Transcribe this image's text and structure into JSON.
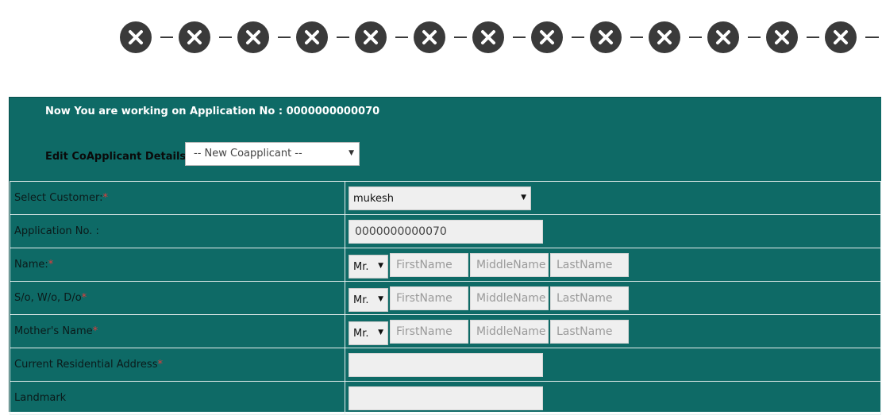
{
  "stepper": {
    "steps": [
      {
        "icon": "close-icon",
        "status": "incomplete"
      },
      {
        "icon": "close-icon",
        "status": "incomplete"
      },
      {
        "icon": "close-icon",
        "status": "incomplete"
      },
      {
        "icon": "close-icon",
        "status": "incomplete"
      },
      {
        "icon": "close-icon",
        "status": "incomplete"
      },
      {
        "icon": "close-icon",
        "status": "incomplete"
      },
      {
        "icon": "close-icon",
        "status": "incomplete"
      },
      {
        "icon": "close-icon",
        "status": "incomplete"
      },
      {
        "icon": "close-icon",
        "status": "incomplete"
      },
      {
        "icon": "close-icon",
        "status": "incomplete"
      },
      {
        "icon": "close-icon",
        "status": "incomplete"
      },
      {
        "icon": "close-icon",
        "status": "incomplete"
      },
      {
        "icon": "close-icon",
        "status": "incomplete"
      }
    ]
  },
  "header": {
    "application_text": "Now You are working on Application No : 0000000000070",
    "coapplicant_label": "Edit CoApplicant Details",
    "coapplicant_selected": "-- New Coapplicant --"
  },
  "form": {
    "select_customer": {
      "label": "Select Customer:",
      "required": "*",
      "value": "mukesh"
    },
    "application_no": {
      "label": "Application No. :",
      "value": "0000000000070"
    },
    "name": {
      "label": "Name:",
      "required": "*",
      "title": "Mr.",
      "first_ph": "FirstName",
      "middle_ph": "MiddleName",
      "last_ph": "LastName"
    },
    "relation": {
      "label": "S/o, W/o, D/o",
      "required": "*",
      "title": "Mr.",
      "first_ph": "FirstName",
      "middle_ph": "MiddleName",
      "last_ph": "LastName"
    },
    "mother": {
      "label": "Mother's Name",
      "required": "*",
      "title": "Mr.",
      "first_ph": "FirstName",
      "middle_ph": "MiddleName",
      "last_ph": "LastName"
    },
    "address": {
      "label": "Current Residential Address",
      "required": "*",
      "value": ""
    },
    "landmark": {
      "label": "Landmark",
      "value": ""
    }
  },
  "colors": {
    "panel": "#0e6a66",
    "step": "#3a3a3a",
    "required": "#e23b3b"
  }
}
